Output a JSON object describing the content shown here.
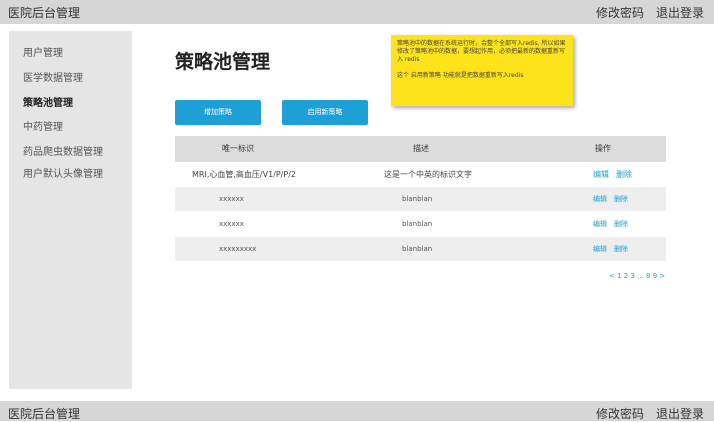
{
  "header": {
    "title": "医院后台管理",
    "change_password": "修改密码",
    "logout": "退出登录"
  },
  "sidebar": {
    "items": [
      {
        "label": "用户管理"
      },
      {
        "label": "医学数据管理"
      },
      {
        "label": "策略池管理"
      },
      {
        "label": "中药管理"
      },
      {
        "label": "药品爬虫数据管理"
      },
      {
        "label": "用户默认头像管理"
      }
    ],
    "active": "策略池管理"
  },
  "main": {
    "title": "策略池管理",
    "note": {
      "line1": "策略池中的数据在系统运行时，会整个全部写入redis, 所以如果修改了策略池中的数据，要想起作用，必须把最新的数据重新写入 redis",
      "line2": "这个 启用新策略 功能就是把数据重新写入redis"
    },
    "add_button": "增加策略",
    "enable_button": "启用新策略",
    "table": {
      "headers": [
        "唯一标识",
        "描述",
        "操作"
      ],
      "rows": [
        {
          "id": "MRI,心血管,高血压/V1/P/P/2",
          "desc": "这是一个中英的标识文字",
          "edit": "编辑",
          "delete": "删除"
        },
        {
          "id": "xxxxxx",
          "desc": "blanblan",
          "edit": "编辑",
          "delete": "删除"
        },
        {
          "id": "xxxxxx",
          "desc": "blanblan",
          "edit": "编辑",
          "delete": "删除"
        },
        {
          "id": "xxxxxxxxx",
          "desc": "blanblan",
          "edit": "编辑",
          "delete": "删除"
        }
      ]
    },
    "pagination": "< 1 2 3 ... 8 9 >"
  },
  "footer": {
    "title": "医院后台管理",
    "change_password": "修改密码",
    "logout": "退出登录"
  },
  "colors": {
    "accent": "#1ea0d6",
    "note_bg": "#ffe31a",
    "bar_bg": "#d6d6d6",
    "sidebar_bg": "#e5e5e5"
  }
}
